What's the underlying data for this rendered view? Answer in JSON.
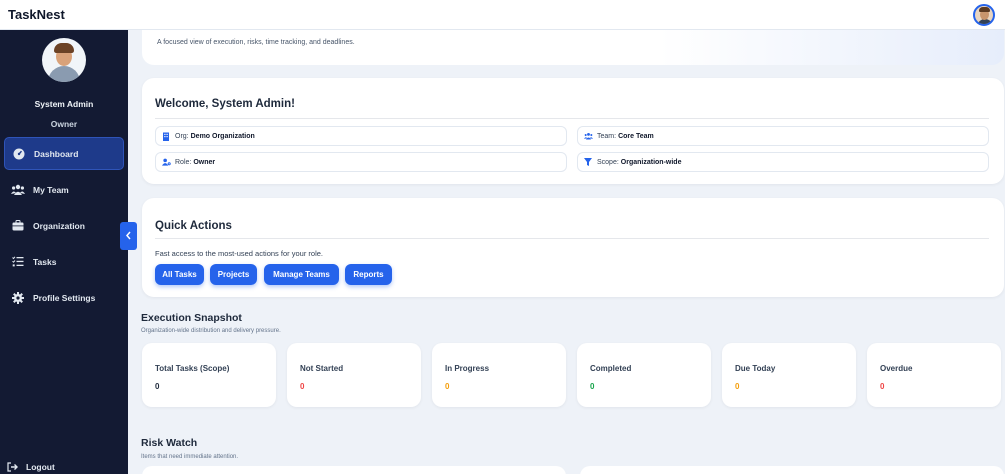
{
  "app": {
    "brand": "TaskNest"
  },
  "sidebar": {
    "profile": {
      "name": "System Admin",
      "role": "Owner"
    },
    "items": [
      {
        "label": "Dashboard",
        "icon": "dashboard-gauge-icon",
        "active": true
      },
      {
        "label": "My Team",
        "icon": "users-icon",
        "active": false
      },
      {
        "label": "Organization",
        "icon": "briefcase-icon",
        "active": false
      },
      {
        "label": "Tasks",
        "icon": "tasks-list-icon",
        "active": false
      },
      {
        "label": "Profile Settings",
        "icon": "gear-icon",
        "active": false
      }
    ],
    "logout": "Logout"
  },
  "hero": {
    "subtitle": "A focused view of execution, risks, time tracking, and deadlines."
  },
  "welcome": {
    "title": "Welcome, System Admin!",
    "org_label": "Org:",
    "org_value": "Demo Organization",
    "team_label": "Team:",
    "team_value": "Core Team",
    "role_label": "Role:",
    "role_value": "Owner",
    "scope_label": "Scope:",
    "scope_value": "Organization-wide"
  },
  "quick_actions": {
    "title": "Quick Actions",
    "subtitle": "Fast access to the most-used actions for your role.",
    "buttons": [
      "All Tasks",
      "Projects",
      "Manage Teams",
      "Reports"
    ]
  },
  "snapshot": {
    "title": "Execution Snapshot",
    "subtitle": "Organization-wide distribution and delivery pressure.",
    "stats": [
      {
        "label": "Total Tasks (Scope)",
        "value": "0",
        "color": "#1e293b"
      },
      {
        "label": "Not Started",
        "value": "0",
        "color": "#ef4444"
      },
      {
        "label": "In Progress",
        "value": "0",
        "color": "#f59e0b"
      },
      {
        "label": "Completed",
        "value": "0",
        "color": "#16a34a"
      },
      {
        "label": "Due Today",
        "value": "0",
        "color": "#f59e0b"
      },
      {
        "label": "Overdue",
        "value": "0",
        "color": "#ef4444"
      }
    ]
  },
  "risk": {
    "title": "Risk Watch",
    "subtitle": "Items that need immediate attention."
  },
  "colors": {
    "accent": "#2563eb",
    "sidebar_bg": "#131a33",
    "page_bg": "#eef2f8"
  }
}
